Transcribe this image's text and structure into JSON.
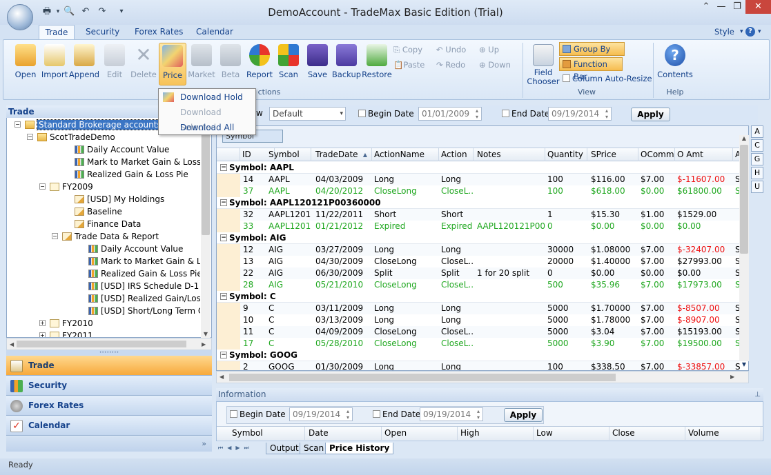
{
  "window": {
    "title": "DemoAccount - TradeMax Basic Edition (Trial)"
  },
  "ribbon_tabs": [
    "Trade",
    "Security",
    "Forex Rates",
    "Calendar"
  ],
  "style_label": "Style",
  "ribbon": {
    "buttons": [
      "Open",
      "Import",
      "Append",
      "Edit",
      "Delete",
      "Price",
      "Market",
      "Beta",
      "Report",
      "Scan",
      "Save",
      "Backup",
      "Restore"
    ],
    "small": {
      "copy": "Copy",
      "paste": "Paste",
      "undo": "Undo",
      "redo": "Redo",
      "up": "Up",
      "down": "Down"
    },
    "field_chooser": "Field Chooser",
    "group_by_box": "Group By Box",
    "function_bar": "Function Bar",
    "column_auto_resize": "Column Auto-Resize",
    "contents": "Contents",
    "group_labels": {
      "actions": "ctions",
      "view": "View",
      "help": "Help"
    }
  },
  "price_menu": {
    "download_hold": "Download Hold",
    "download_selected": "Download Selected",
    "download_all": "Download All"
  },
  "left_panel": {
    "header": "Trade",
    "tree": [
      {
        "label": "Standard Brokerage accounts",
        "icon": "folder-search-icon"
      },
      {
        "label": "ScotTradeDemo",
        "icon": "folder-icon"
      },
      {
        "label": "Daily Account Value",
        "icon": "chart-icon"
      },
      {
        "label": "Mark to Market Gain & Loss Pie",
        "icon": "chart-icon"
      },
      {
        "label": "Realized Gain & Loss Pie",
        "icon": "chart-icon"
      },
      {
        "label": "FY2009",
        "icon": "document-icon"
      },
      {
        "label": "[USD] My Holdings",
        "icon": "edit-icon"
      },
      {
        "label": "Baseline",
        "icon": "edit-icon"
      },
      {
        "label": "Finance Data",
        "icon": "edit-icon"
      },
      {
        "label": "Trade Data & Report",
        "icon": "edit-icon"
      },
      {
        "label": "Daily Account Value",
        "icon": "chart-icon"
      },
      {
        "label": "Mark to Market Gain & Los",
        "icon": "chart-icon"
      },
      {
        "label": "Realized Gain & Loss Pie",
        "icon": "chart-icon"
      },
      {
        "label": "[USD] IRS Schedule D-1",
        "icon": "chart-icon"
      },
      {
        "label": "[USD] Realized Gain/Loss Re",
        "icon": "line-chart-icon"
      },
      {
        "label": "[USD] Short/Long Term Cap",
        "icon": "cube-chart-icon"
      },
      {
        "label": "FY2010",
        "icon": "document-icon"
      },
      {
        "label": "FY2011",
        "icon": "document-icon"
      }
    ]
  },
  "nav": [
    "Trade",
    "Security",
    "Forex Rates",
    "Calendar"
  ],
  "filter": {
    "view_label": "w",
    "view_value": "Default",
    "begin_date_label": "Begin Date",
    "begin_date": "01/01/2009",
    "end_date_label": "End Date",
    "end_date": "09/19/2014",
    "apply": "Apply"
  },
  "grid": {
    "group_box_chip": "Symbol",
    "columns": [
      "ID",
      "Symbol",
      "TradeDate",
      "ActionName",
      "Action",
      "Notes",
      "Quantity",
      "SPrice",
      "OComm",
      "O Amt",
      "A"
    ],
    "alpha": [
      "A",
      "C",
      "G",
      "H",
      "U"
    ],
    "groups": [
      {
        "title": "Symbol: AAPL",
        "rows": [
          {
            "id": "14",
            "symbol": "AAPL",
            "date": "04/03/2009",
            "action_name": "Long",
            "action": "Long",
            "notes": "",
            "qty": "100",
            "sprice": "$116.00",
            "ocomm": "$7.00",
            "oamt": "$-11607.00",
            "a": "S",
            "style": "normal"
          },
          {
            "id": "37",
            "symbol": "AAPL",
            "date": "04/20/2012",
            "action_name": "CloseLong",
            "action": "CloseL...",
            "notes": "",
            "qty": "100",
            "sprice": "$618.00",
            "ocomm": "$0.00",
            "oamt": "$61800.00",
            "a": "S",
            "style": "green"
          }
        ]
      },
      {
        "title": "Symbol: AAPL120121P00360000",
        "rows": [
          {
            "id": "32",
            "symbol": "AAPL1201...",
            "date": "11/22/2011",
            "action_name": "Short",
            "action": "Short",
            "notes": "",
            "qty": "1",
            "sprice": "$15.30",
            "ocomm": "$1.00",
            "oamt": "$1529.00",
            "a": "",
            "style": "normal"
          },
          {
            "id": "33",
            "symbol": "AAPL1201...",
            "date": "01/21/2012",
            "action_name": "Expired",
            "action": "Expired",
            "notes": "AAPL120121P00...",
            "qty": "0",
            "sprice": "$0.00",
            "ocomm": "$0.00",
            "oamt": "$0.00",
            "a": "",
            "style": "green"
          }
        ]
      },
      {
        "title": "Symbol: AIG",
        "rows": [
          {
            "id": "12",
            "symbol": "AIG",
            "date": "03/27/2009",
            "action_name": "Long",
            "action": "Long",
            "notes": "",
            "qty": "30000",
            "sprice": "$1.08000",
            "ocomm": "$7.00",
            "oamt": "$-32407.00",
            "a": "S",
            "style": "normal"
          },
          {
            "id": "13",
            "symbol": "AIG",
            "date": "04/30/2009",
            "action_name": "CloseLong",
            "action": "CloseL...",
            "notes": "",
            "qty": "20000",
            "sprice": "$1.40000",
            "ocomm": "$7.00",
            "oamt": "$27993.00",
            "a": "S",
            "style": "normal"
          },
          {
            "id": "22",
            "symbol": "AIG",
            "date": "06/30/2009",
            "action_name": "Split",
            "action": "Split",
            "notes": "1 for 20 split",
            "qty": "0",
            "sprice": "$0.00",
            "ocomm": "$0.00",
            "oamt": "$0.00",
            "a": "S",
            "style": "normal"
          },
          {
            "id": "28",
            "symbol": "AIG",
            "date": "05/21/2010",
            "action_name": "CloseLong",
            "action": "CloseL...",
            "notes": "",
            "qty": "500",
            "sprice": "$35.96",
            "ocomm": "$7.00",
            "oamt": "$17973.00",
            "a": "S",
            "style": "green"
          }
        ]
      },
      {
        "title": "Symbol: C",
        "rows": [
          {
            "id": "9",
            "symbol": "C",
            "date": "03/11/2009",
            "action_name": "Long",
            "action": "Long",
            "notes": "",
            "qty": "5000",
            "sprice": "$1.70000",
            "ocomm": "$7.00",
            "oamt": "$-8507.00",
            "a": "S",
            "style": "normal"
          },
          {
            "id": "10",
            "symbol": "C",
            "date": "03/13/2009",
            "action_name": "Long",
            "action": "Long",
            "notes": "",
            "qty": "5000",
            "sprice": "$1.78000",
            "ocomm": "$7.00",
            "oamt": "$-8907.00",
            "a": "S",
            "style": "normal"
          },
          {
            "id": "11",
            "symbol": "C",
            "date": "04/09/2009",
            "action_name": "CloseLong",
            "action": "CloseL...",
            "notes": "",
            "qty": "5000",
            "sprice": "$3.04",
            "ocomm": "$7.00",
            "oamt": "$15193.00",
            "a": "S",
            "style": "normal"
          },
          {
            "id": "17",
            "symbol": "C",
            "date": "05/28/2010",
            "action_name": "CloseLong",
            "action": "CloseL...",
            "notes": "",
            "qty": "5000",
            "sprice": "$3.90",
            "ocomm": "$7.00",
            "oamt": "$19500.00",
            "a": "S",
            "style": "green"
          }
        ]
      },
      {
        "title": "Symbol: GOOG",
        "rows": [
          {
            "id": "2",
            "symbol": "GOOG",
            "date": "01/30/2009",
            "action_name": "Long",
            "action": "Long",
            "notes": "",
            "qty": "100",
            "sprice": "$338.50",
            "ocomm": "$7.00",
            "oamt": "$-33857.00",
            "a": "S",
            "style": "normal"
          }
        ]
      }
    ]
  },
  "info": {
    "header": "Information",
    "begin_date_label": "Begin Date",
    "begin_date": "09/19/2014",
    "end_date_label": "End Date",
    "end_date": "09/19/2014",
    "apply": "Apply",
    "columns": [
      "Symbol",
      "Date",
      "Open",
      "High",
      "Low",
      "Close",
      "Volume"
    ]
  },
  "bottom_tabs": [
    "Output",
    "Scan",
    "Price History"
  ],
  "status": "Ready",
  "colors": {
    "accent": "#15428b",
    "selected_nav": "#f7a93b",
    "loss": "#e11111",
    "closed": "#1fa71f"
  }
}
